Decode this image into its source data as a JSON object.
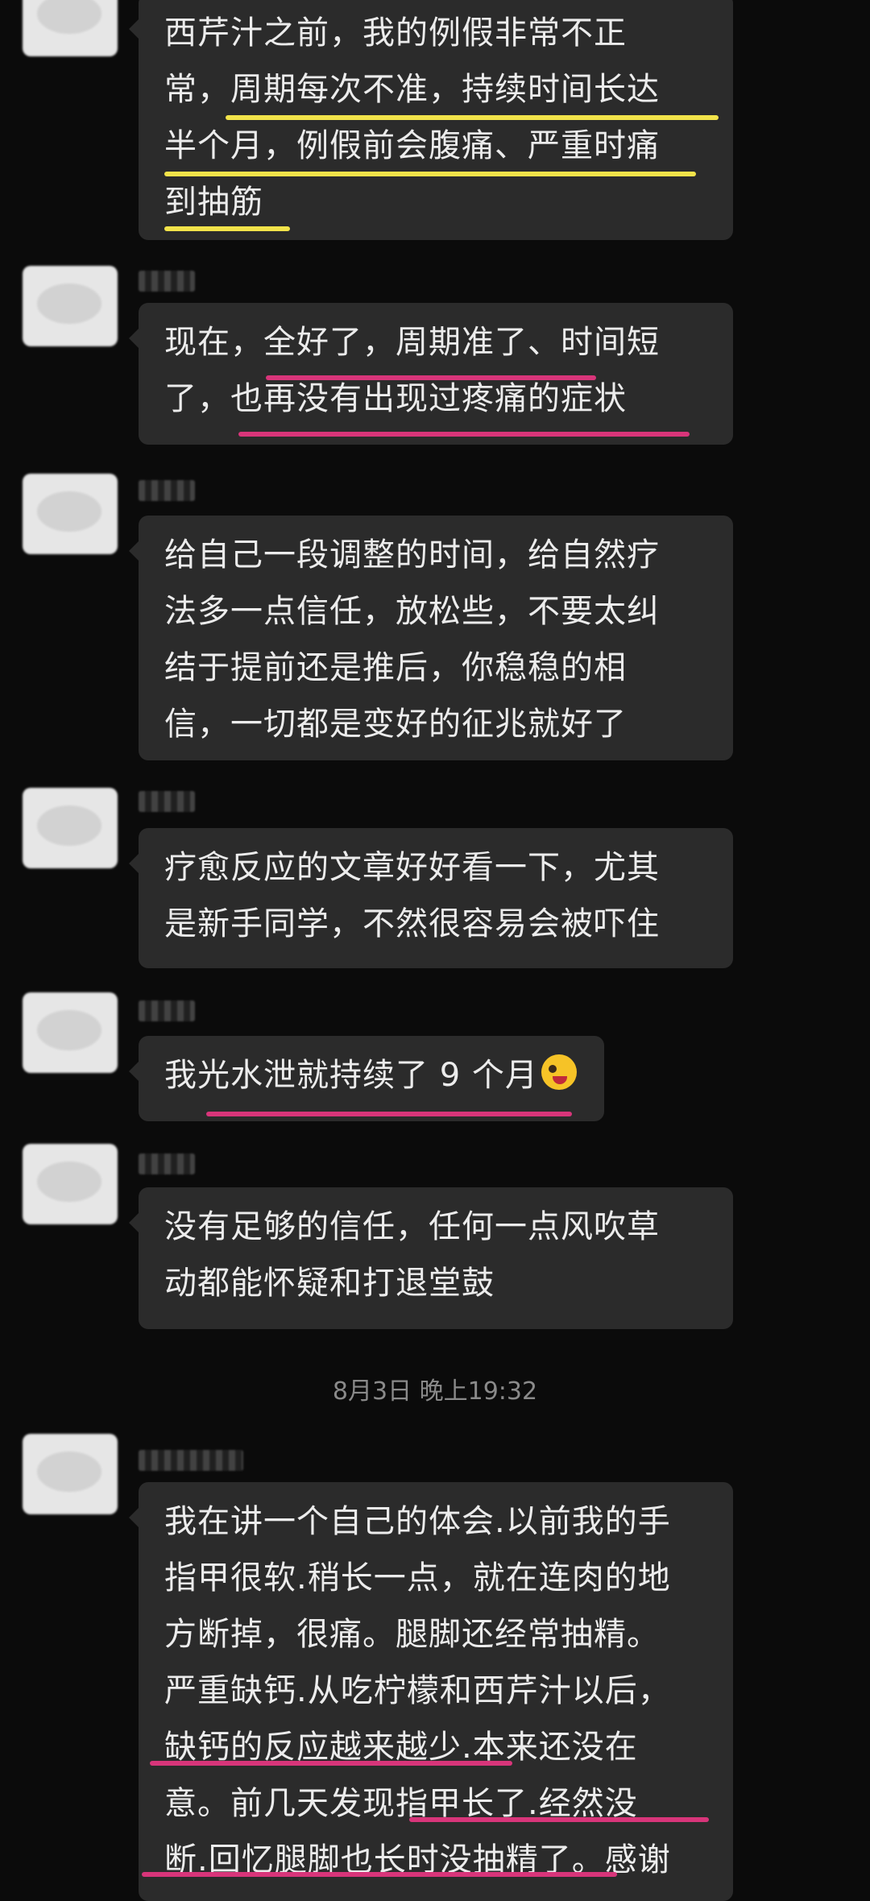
{
  "messages": [
    {
      "text": "西芹汁之前，我的例假非常不正\n常，周期每次不准，持续时间长达\n半个月，例假前会腹痛、严重时痛\n到抽筋"
    },
    {
      "text": "现在，全好了，周期准了、时间短\n了，也再没有出现过疼痛的症状"
    },
    {
      "text": "给自己一段调整的时间，给自然疗\n法多一点信任，放松些，不要太纠\n结于提前还是推后，你稳稳的相\n信，一切都是变好的征兆就好了"
    },
    {
      "text": "疗愈反应的文章好好看一下，尤其\n是新手同学，不然很容易会被吓住"
    },
    {
      "text": "我光水泄就持续了 9 个月",
      "emoji": "winking-tongue-emoji"
    },
    {
      "text": "没有足够的信任，任何一点风吹草\n动都能怀疑和打退堂鼓"
    },
    {
      "text": "我在讲一个自己的体会.以前我的手\n指甲很软.稍长一点，就在连肉的地\n方断掉，很痛。腿脚还经常抽精。\n严重缺钙.从吃柠檬和西芹汁以后，\n缺钙的反应越来越少.本来还没在\n意。前几天发现指甲长了.经然没\n断.回忆腿脚也长时没抽精了。感谢"
    }
  ],
  "timestamp": "8月3日 晚上19:32",
  "colors": {
    "highlight_yellow": "#f2e34a",
    "highlight_pink": "#d8357a",
    "bubble": "#2b2b2b",
    "background": "#0b0b0b"
  }
}
